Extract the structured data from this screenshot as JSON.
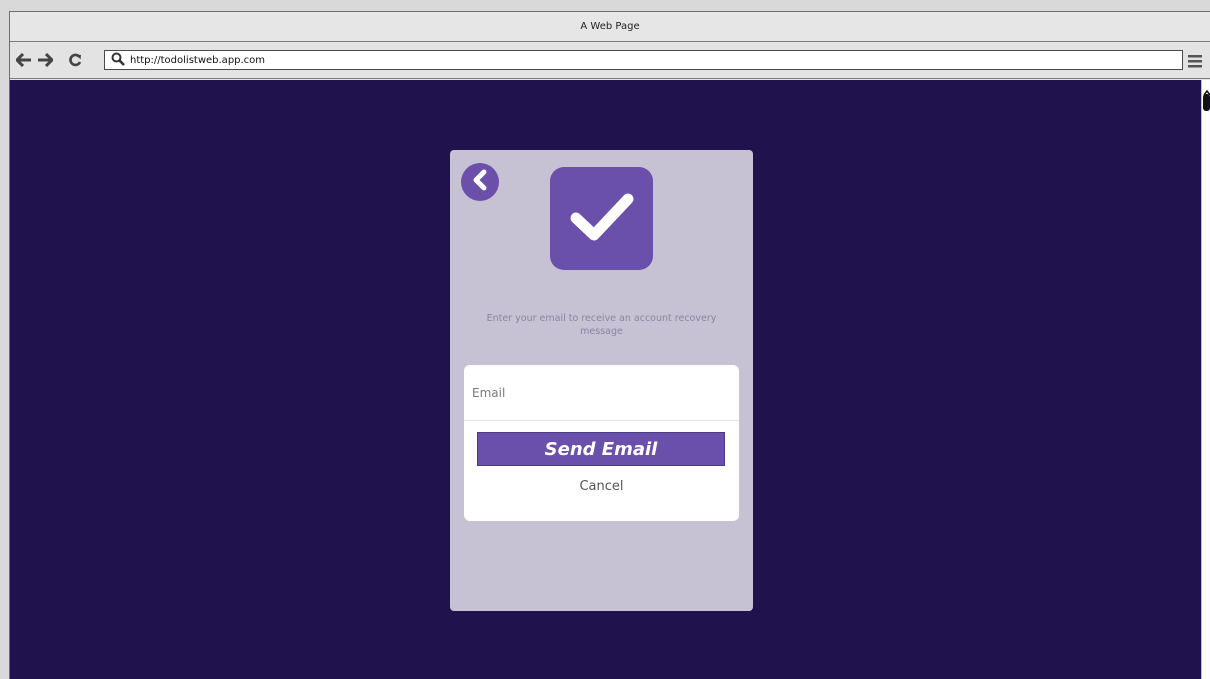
{
  "window": {
    "title": "A Web Page"
  },
  "browser": {
    "url": "http://todolistweb.app.com",
    "icons": [
      "back-arrow-icon",
      "forward-arrow-icon",
      "refresh-icon",
      "search-icon",
      "hamburger-menu-icon"
    ]
  },
  "page": {
    "instructions": "Enter your email to receive an account recovery message",
    "email_placeholder": "Email",
    "send_label": "Send Email",
    "cancel_label": "Cancel"
  },
  "colors": {
    "page_background": "#20134d",
    "card_background": "#c6c2d3",
    "accent": "#6a4fab"
  }
}
